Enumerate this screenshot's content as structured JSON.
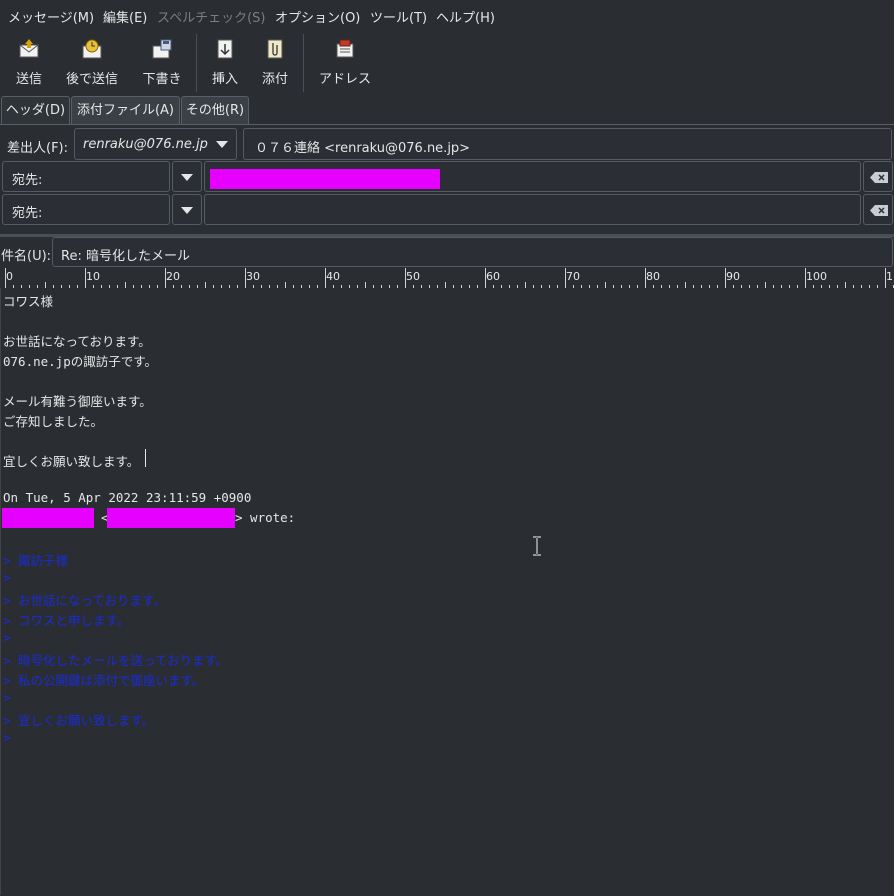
{
  "menu": [
    "メッセージ(M)",
    "編集(E)",
    "スペルチェック(S)",
    "オプション(O)",
    "ツール(T)",
    "ヘルプ(H)"
  ],
  "toolbar": {
    "send": "送信",
    "send_later": "後で送信",
    "draft": "下書き",
    "insert": "挿入",
    "attach": "添付",
    "address": "アドレス"
  },
  "tabs": [
    "ヘッダ(D)",
    "添付ファイル(A)",
    "その他(R)"
  ],
  "header": {
    "from_label": "差出人(F):",
    "account": "renraku@076.ne.jp",
    "from_value": "０７６連絡 <renraku@076.ne.jp>",
    "to_type_1": "宛先:",
    "to_type_2": "宛先:",
    "subject_label": "件名(U):",
    "subject_value": "Re: 暗号化したメール"
  },
  "ruler": [
    "0",
    "10",
    "20",
    "30",
    "40",
    "50",
    "60",
    "70",
    "80",
    "90",
    "100",
    "1"
  ],
  "body": {
    "l1": "コワス様",
    "l3": "お世話になっております。",
    "l4": "076.ne.jpの諏訪子です。",
    "l6": "メール有難う御座います。",
    "l7": "ご存知しました。",
    "l9": "宜しくお願い致します。",
    "l11": "On Tue, 5 Apr 2022 23:11:59 +0900",
    "l12_lt": "<",
    "l12_gt": "> wrote:",
    "q1": "> 諏訪子様",
    "q2": ">",
    "q3": "> お世話になっております。",
    "q4": "> コワスと申します。",
    "q5": ">",
    "q6": "> 暗号化したメールを送っております。",
    "q7": "> 私の公開鍵は添付で御座います。",
    "q8": ">",
    "q9": "> 宜しくお願い致します。",
    "q10": ">"
  },
  "colors": {
    "redaction": "#e600ff",
    "quote": "#1a2bd6",
    "background": "#2a2e33"
  }
}
